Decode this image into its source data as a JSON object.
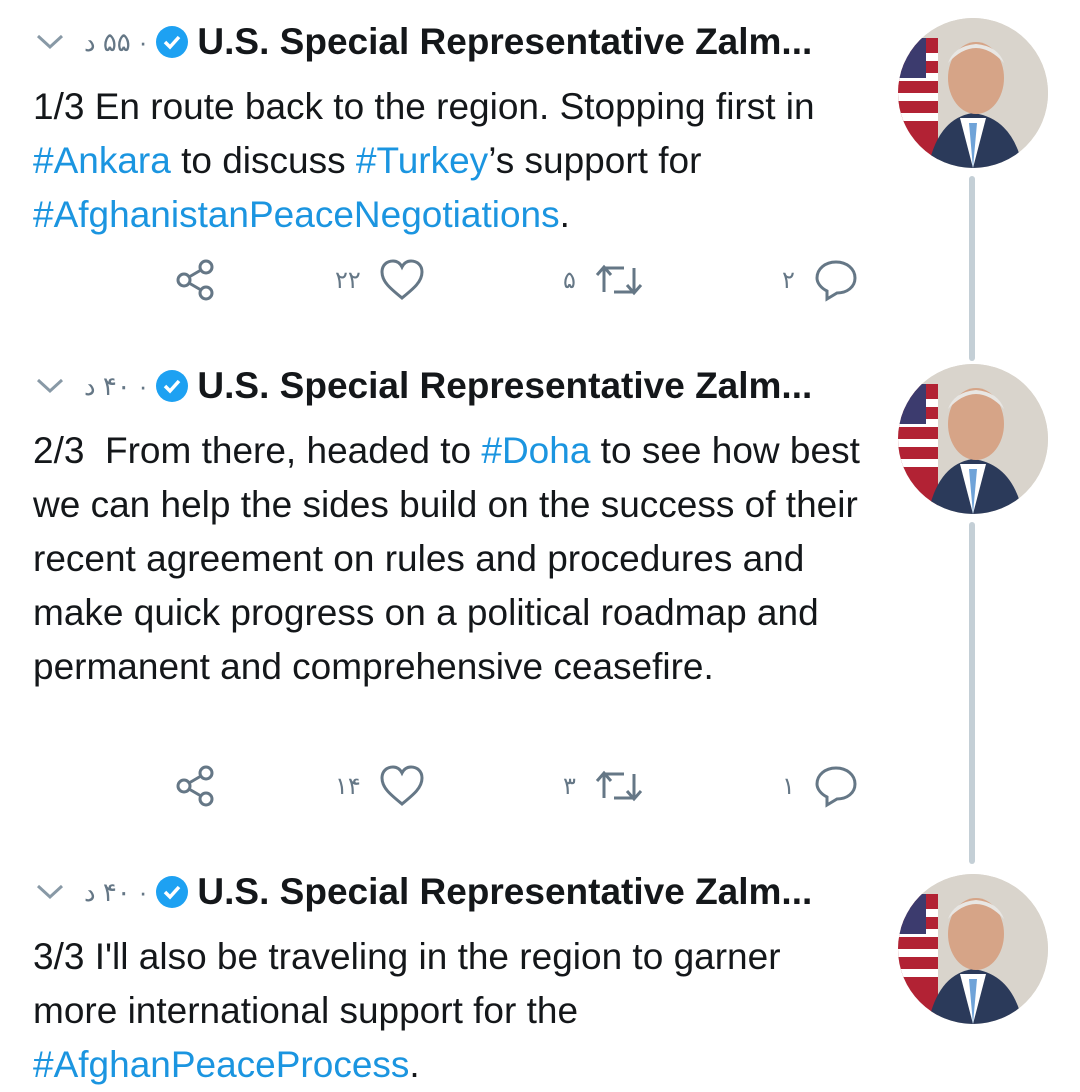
{
  "tweets": [
    {
      "time": "۵۵ د",
      "name": "U.S. Special Representative Zalm...",
      "text_parts": [
        {
          "t": "1/3 En route back to the region. Stopping first in ",
          "h": false
        },
        {
          "t": "#Ankara",
          "h": true
        },
        {
          "t": " to discuss ",
          "h": false
        },
        {
          "t": "#Turkey",
          "h": true
        },
        {
          "t": "’s support for ",
          "h": false
        },
        {
          "t": "#AfghanistanPeaceNegotiations",
          "h": true
        },
        {
          "t": ".",
          "h": false
        }
      ],
      "likes": "۲۲",
      "retweets": "۵",
      "replies": "۲"
    },
    {
      "time": "۴۰ د",
      "name": "U.S. Special Representative Zalm...",
      "text_parts": [
        {
          "t": "2/3  From there, headed to ",
          "h": false
        },
        {
          "t": "#Doha",
          "h": true
        },
        {
          "t": " to see how best we can help the sides build on the success of their recent agreement on rules and procedures and make quick progress on a political roadmap and permanent and comprehensive ceasefire.",
          "h": false
        }
      ],
      "likes": "۱۴",
      "retweets": "۳",
      "replies": "۱"
    },
    {
      "time": "۴۰ د",
      "name": "U.S. Special Representative Zalm...",
      "text_parts": [
        {
          "t": "3/3 I'll also be traveling in the region to garner more international support for the ",
          "h": false
        },
        {
          "t": "#AfghanPeaceProcess",
          "h": true
        },
        {
          "t": ".",
          "h": false
        }
      ]
    }
  ],
  "colors": {
    "hashtag": "#1b95e0",
    "verified": "#1da1f2",
    "muted": "#657786",
    "thread_line": "#c4cfd6"
  },
  "icons": [
    "chevron-down-icon",
    "verified-badge-icon",
    "share-icon",
    "like-icon",
    "retweet-icon",
    "reply-icon"
  ]
}
